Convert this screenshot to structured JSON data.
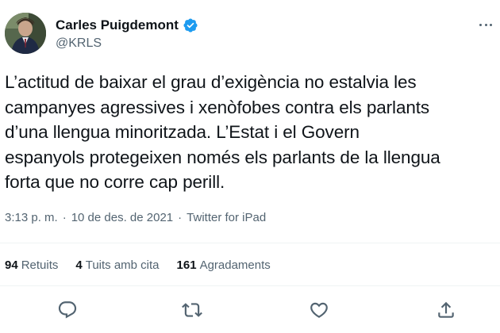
{
  "author": {
    "display_name": "Carles Puigdemont",
    "handle": "@KRLS",
    "verified": true,
    "avatar_icon": "profile-photo",
    "verified_icon": "verified-badge-icon"
  },
  "tweet": {
    "text": "L’actitud de baixar el grau d’exigència no estalvia les\ncampanyes agressives i xenòfobes contra els parlants\nd’una llengua minoritzada. L’Estat i el Govern\nespanyols protegeixen només els parlants de la llengua\nforta que no corre cap perill."
  },
  "meta": {
    "time": "3:13 p. m.",
    "separator": "·",
    "date": "10 de des. de 2021",
    "client": "Twitter for iPad"
  },
  "stats": {
    "retweets_count": "94",
    "retweets_label": "Retuits",
    "quotes_count": "4",
    "quotes_label": "Tuits amb cita",
    "likes_count": "161",
    "likes_label": "Agradaments"
  },
  "actions": {
    "reply_icon": "reply-icon",
    "retweet_icon": "retweet-icon",
    "like_icon": "heart-icon",
    "share_icon": "share-icon"
  },
  "colors": {
    "text": "#0f1419",
    "secondary": "#536471",
    "verified": "#1d9bf0",
    "divider": "#eff3f4"
  }
}
